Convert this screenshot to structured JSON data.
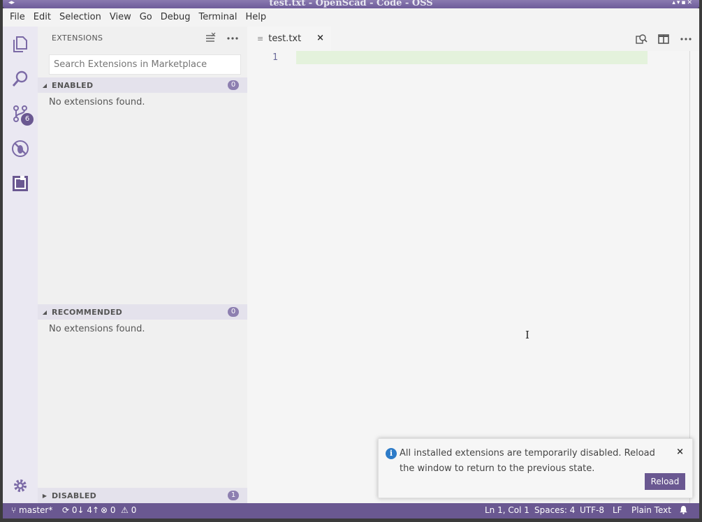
{
  "window": {
    "title": "test.txt - OpenScad - Code - OSS",
    "left_controls": "◂▸",
    "right_controls": "▴▾▪✕"
  },
  "menu": [
    "File",
    "Edit",
    "Selection",
    "View",
    "Go",
    "Debug",
    "Terminal",
    "Help"
  ],
  "activity_bar": {
    "items": [
      {
        "name": "explorer",
        "icon": "files-icon"
      },
      {
        "name": "search",
        "icon": "search-icon"
      },
      {
        "name": "source-control",
        "icon": "source-control-icon",
        "badge": "6"
      },
      {
        "name": "debug",
        "icon": "debug-icon"
      },
      {
        "name": "extensions",
        "icon": "extensions-icon"
      }
    ],
    "settings_icon": "gear-icon"
  },
  "sidebar": {
    "title": "EXTENSIONS",
    "search_placeholder": "Search Extensions in Marketplace",
    "sections": [
      {
        "label": "ENABLED",
        "count": "0",
        "expanded": true,
        "message": "No extensions found."
      },
      {
        "label": "RECOMMENDED",
        "count": "0",
        "expanded": true,
        "message": "No extensions found."
      },
      {
        "label": "DISABLED",
        "count": "1",
        "expanded": false
      }
    ]
  },
  "editor": {
    "tab_label": "test.txt",
    "tab_close": "×",
    "line_number": "1"
  },
  "notification": {
    "message": "All installed extensions are temporarily disabled. Reload the window to return to the previous state.",
    "close": "×",
    "button": "Reload"
  },
  "status_bar": {
    "branch": "master*",
    "sync": "0↓ 4↑",
    "errors": "0",
    "warnings": "0",
    "position": "Ln 1, Col 1",
    "spaces": "Spaces: 4",
    "encoding": "UTF-8",
    "eol": "LF",
    "language": "Plain Text"
  },
  "colors": {
    "accent": "#6a5891",
    "badge": "#8d7fb0",
    "activity_icon": "#7b6aa6",
    "line_highlight": "#e4f2dc"
  }
}
